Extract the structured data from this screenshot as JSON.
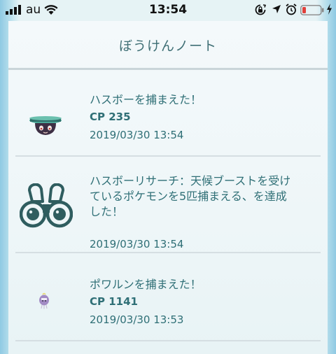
{
  "status_bar": {
    "carrier": "au",
    "time": "13:54"
  },
  "header": {
    "title": "ぼうけんノート"
  },
  "entries": [
    {
      "kind": "catch",
      "icon": "lampent-sprite",
      "title": "ハスボーを捕まえた！",
      "cp": "CP 235",
      "date": "2019/03/30 13:54"
    },
    {
      "kind": "research",
      "icon": "binoculars-icon",
      "title_lines": [
        "ハスボーリサーチ：天候ブーストを受け",
        "ているポケモンを5匹捕まえる、を達成",
        "した！"
      ],
      "date": "2019/03/30 13:54"
    },
    {
      "kind": "catch",
      "icon": "drifloon-sprite",
      "title": "ポワルンを捕まえた！",
      "cp": "CP 1141",
      "date": "2019/03/30 13:53"
    }
  ],
  "colors": {
    "accent_text": "#2f6f76",
    "title_text": "#3f6f75",
    "battery_low": "#e0403a"
  }
}
